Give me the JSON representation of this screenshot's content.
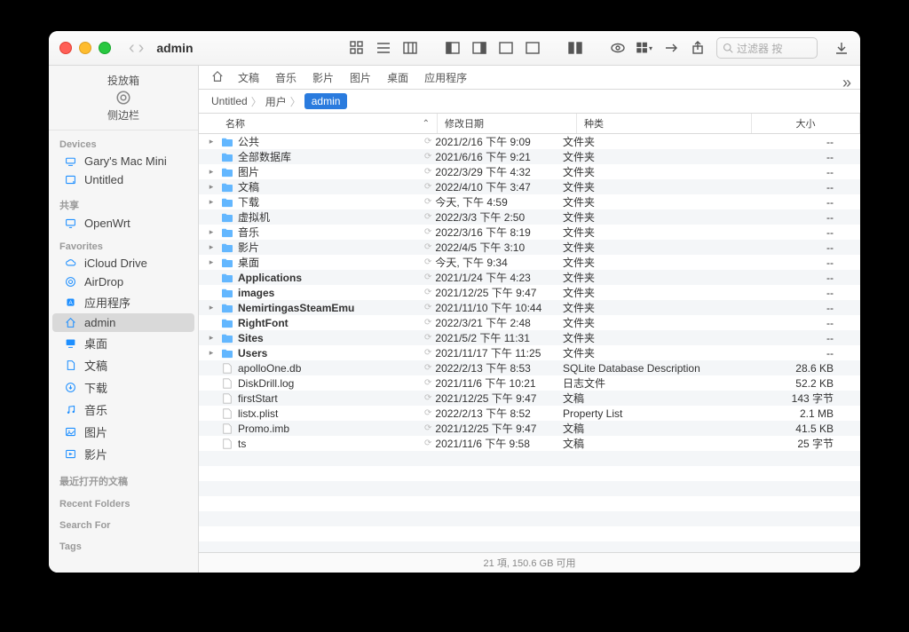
{
  "window": {
    "title": "admin"
  },
  "toolbar": {
    "search_placeholder": "过滤器 按"
  },
  "sidebar": {
    "top1": "投放箱",
    "top2": "侧边栏",
    "groups": [
      {
        "label": "Devices",
        "items": [
          {
            "icon": "device",
            "label": "Gary's Mac Mini"
          },
          {
            "icon": "disk",
            "label": "Untitled"
          }
        ]
      },
      {
        "label": "共享",
        "items": [
          {
            "icon": "display",
            "label": "OpenWrt"
          }
        ]
      },
      {
        "label": "Favorites",
        "items": [
          {
            "icon": "cloud",
            "label": "iCloud Drive"
          },
          {
            "icon": "airdrop",
            "label": "AirDrop"
          },
          {
            "icon": "app",
            "label": "应用程序"
          },
          {
            "icon": "home",
            "label": "admin",
            "selected": true
          },
          {
            "icon": "desktop",
            "label": "桌面"
          },
          {
            "icon": "doc",
            "label": "文稿"
          },
          {
            "icon": "download",
            "label": "下载"
          },
          {
            "icon": "music",
            "label": "音乐"
          },
          {
            "icon": "picture",
            "label": "图片"
          },
          {
            "icon": "movie",
            "label": "影片"
          }
        ]
      },
      {
        "label": "最近打开的文稿",
        "items": []
      },
      {
        "label": "Recent Folders",
        "items": []
      },
      {
        "label": "Search For",
        "items": []
      },
      {
        "label": "Tags",
        "items": []
      }
    ]
  },
  "tabs": [
    "文稿",
    "音乐",
    "影片",
    "图片",
    "桌面",
    "应用程序"
  ],
  "path": [
    "Untitled",
    "用户",
    "admin"
  ],
  "columns": {
    "name": "名称",
    "date": "修改日期",
    "kind": "种类",
    "size": "大小"
  },
  "rows": [
    {
      "exp": true,
      "type": "folder",
      "name": "公共",
      "date": "2021/2/16 下午 9:09",
      "kind": "文件夹",
      "size": "--"
    },
    {
      "exp": false,
      "type": "folder",
      "name": "全部数据库",
      "date": "2021/6/16 下午 9:21",
      "kind": "文件夹",
      "size": "--"
    },
    {
      "exp": true,
      "type": "folder",
      "name": "图片",
      "date": "2022/3/29 下午 4:32",
      "kind": "文件夹",
      "size": "--"
    },
    {
      "exp": true,
      "type": "folder",
      "name": "文稿",
      "date": "2022/4/10 下午 3:47",
      "kind": "文件夹",
      "size": "--"
    },
    {
      "exp": true,
      "type": "folder",
      "name": "下载",
      "date": "今天, 下午 4:59",
      "kind": "文件夹",
      "size": "--"
    },
    {
      "exp": false,
      "type": "folder",
      "name": "虚拟机",
      "date": "2022/3/3 下午 2:50",
      "kind": "文件夹",
      "size": "--"
    },
    {
      "exp": true,
      "type": "folder",
      "name": "音乐",
      "date": "2022/3/16 下午 8:19",
      "kind": "文件夹",
      "size": "--"
    },
    {
      "exp": true,
      "type": "folder",
      "name": "影片",
      "date": "2022/4/5 下午 3:10",
      "kind": "文件夹",
      "size": "--"
    },
    {
      "exp": true,
      "type": "folder",
      "name": "桌面",
      "date": "今天, 下午 9:34",
      "kind": "文件夹",
      "size": "--"
    },
    {
      "exp": false,
      "type": "folder",
      "name": "Applications",
      "bold": true,
      "date": "2021/1/24 下午 4:23",
      "kind": "文件夹",
      "size": "--"
    },
    {
      "exp": false,
      "type": "folder",
      "name": "images",
      "bold": true,
      "date": "2021/12/25 下午 9:47",
      "kind": "文件夹",
      "size": "--"
    },
    {
      "exp": true,
      "type": "folder",
      "name": "NemirtingasSteamEmu",
      "bold": true,
      "date": "2021/11/10 下午 10:44",
      "kind": "文件夹",
      "size": "--"
    },
    {
      "exp": false,
      "type": "folder",
      "name": "RightFont",
      "bold": true,
      "date": "2022/3/21 下午 2:48",
      "kind": "文件夹",
      "size": "--"
    },
    {
      "exp": true,
      "type": "folder",
      "name": "Sites",
      "bold": true,
      "date": "2021/5/2 下午 11:31",
      "kind": "文件夹",
      "size": "--"
    },
    {
      "exp": true,
      "type": "folder",
      "name": "Users",
      "bold": true,
      "date": "2021/11/17 下午 11:25",
      "kind": "文件夹",
      "size": "--"
    },
    {
      "exp": false,
      "type": "file",
      "name": "apolloOne.db",
      "date": "2022/2/13 下午 8:53",
      "kind": "SQLite Database Description",
      "size": "28.6 KB"
    },
    {
      "exp": false,
      "type": "file",
      "name": "DiskDrill.log",
      "date": "2021/11/6 下午 10:21",
      "kind": "日志文件",
      "size": "52.2 KB"
    },
    {
      "exp": false,
      "type": "file",
      "name": "firstStart",
      "date": "2021/12/25 下午 9:47",
      "kind": "文稿",
      "size": "143 字节"
    },
    {
      "exp": false,
      "type": "file",
      "name": "listx.plist",
      "date": "2022/2/13 下午 8:52",
      "kind": "Property List",
      "size": "2.1 MB"
    },
    {
      "exp": false,
      "type": "file",
      "name": "Promo.imb",
      "date": "2021/12/25 下午 9:47",
      "kind": "文稿",
      "size": "41.5 KB"
    },
    {
      "exp": false,
      "type": "file",
      "name": "ts",
      "date": "2021/11/6 下午 9:58",
      "kind": "文稿",
      "size": "25 字节"
    }
  ],
  "status": "21 項, 150.6 GB 可用"
}
